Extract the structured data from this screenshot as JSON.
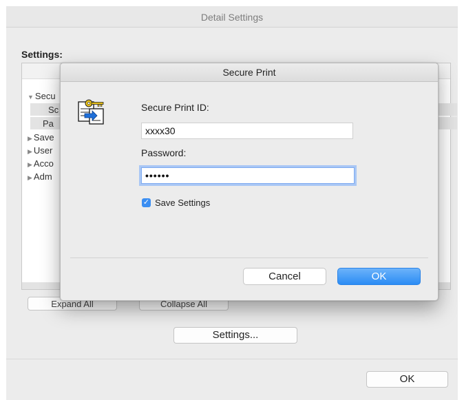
{
  "window": {
    "title": "Detail Settings"
  },
  "settings_label": "Settings:",
  "tree": {
    "items": [
      {
        "label": "Secu",
        "expanded": true
      },
      {
        "label": "Sc"
      },
      {
        "label": "Pa"
      },
      {
        "label": "Save",
        "expanded": false
      },
      {
        "label": "User",
        "expanded": false
      },
      {
        "label": "Acco",
        "expanded": false
      },
      {
        "label": "Adm",
        "expanded": false
      }
    ]
  },
  "buttons": {
    "expand_all": "Expand All",
    "collapse_all": "Collapse All",
    "settings": "Settings...",
    "ok": "OK"
  },
  "dialog": {
    "title": "Secure Print",
    "icon": "secure-print-key-icon",
    "id_label": "Secure Print ID:",
    "id_value": "xxxx30",
    "password_label": "Password:",
    "password_value": "••••••",
    "save_settings_label": "Save Settings",
    "save_settings_checked": true,
    "cancel_label": "Cancel",
    "ok_label": "OK"
  },
  "colors": {
    "accent": "#2b8cf4",
    "focus_ring": "#a9c7f5"
  }
}
